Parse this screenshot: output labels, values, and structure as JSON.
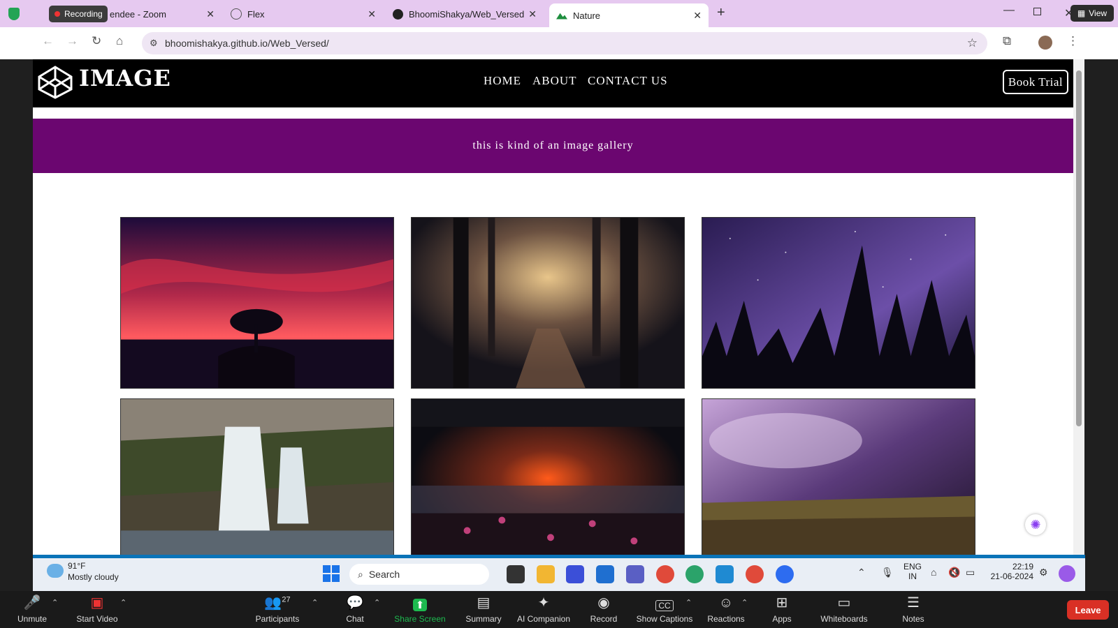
{
  "zoom_overlay": {
    "recording": "Recording",
    "view_label": "View"
  },
  "browser": {
    "tabs": [
      {
        "title": "endee - Zoom"
      },
      {
        "title": "Flex"
      },
      {
        "title": "BhoomiShakya/Web_Versed"
      },
      {
        "title": "Nature"
      }
    ],
    "url": "bhoomishakya.github.io/Web_Versed/"
  },
  "site": {
    "logo_text": "IMAGE",
    "nav": [
      "HOME",
      "ABOUT",
      "CONTACT US"
    ],
    "cta": "Book Trial",
    "banner_text": "this is kind of an image gallery",
    "gallery": [
      {
        "name": "red-sky-tree"
      },
      {
        "name": "misty-forest-path"
      },
      {
        "name": "starry-pine-forest"
      },
      {
        "name": "waterfall"
      },
      {
        "name": "sunset-lake-flowers"
      },
      {
        "name": "purple-storm-field"
      }
    ]
  },
  "taskbar": {
    "weather_temp": "91°F",
    "weather_desc": "Mostly cloudy",
    "search_placeholder": "Search",
    "lang_line1": "ENG",
    "lang_line2": "IN",
    "time": "22:19",
    "date": "21-06-2024"
  },
  "zoom_bar": {
    "unmute": "Unmute",
    "start_video": "Start Video",
    "participants": "Participants",
    "participants_count": "27",
    "chat": "Chat",
    "share_screen": "Share Screen",
    "summary": "Summary",
    "ai_companion": "AI Companion",
    "record": "Record",
    "show_captions": "Show Captions",
    "reactions": "Reactions",
    "apps": "Apps",
    "whiteboards": "Whiteboards",
    "notes": "Notes",
    "leave": "Leave"
  },
  "colors": {
    "banner": "#6b0670",
    "header": "#000000",
    "tabbar": "#e6c9f0",
    "leave": "#d93025",
    "share": "#1dba4f"
  }
}
